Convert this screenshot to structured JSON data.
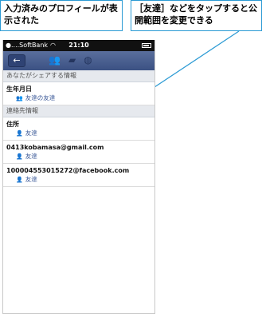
{
  "callouts": {
    "left": "入力済みのプロフィールが表示された",
    "right": "［友達］などをタップすると公開範囲を変更できる"
  },
  "status_bar": {
    "carrier": "●....SoftBank",
    "time": "21:10"
  },
  "nav": {
    "back_label": "←"
  },
  "sections": [
    {
      "heading": "あなたがシェアする情報"
    },
    {
      "heading": "連絡先情報"
    }
  ],
  "fields": [
    {
      "label": "生年月日",
      "audience": "友達の友達"
    },
    {
      "label": "住所",
      "audience": "友達"
    },
    {
      "label": "0413kobamasa@gmail.com",
      "audience": "友達"
    },
    {
      "label": "100004553015272@facebook.com",
      "audience": "友達"
    }
  ],
  "colors": {
    "callout_border": "#2a9ad4",
    "navbar": "#3b5183",
    "link": "#3b5998"
  },
  "icons": {
    "audience": "people-icon",
    "friends": "friends-icon",
    "messages": "messages-icon",
    "notifications": "globe-icon"
  }
}
